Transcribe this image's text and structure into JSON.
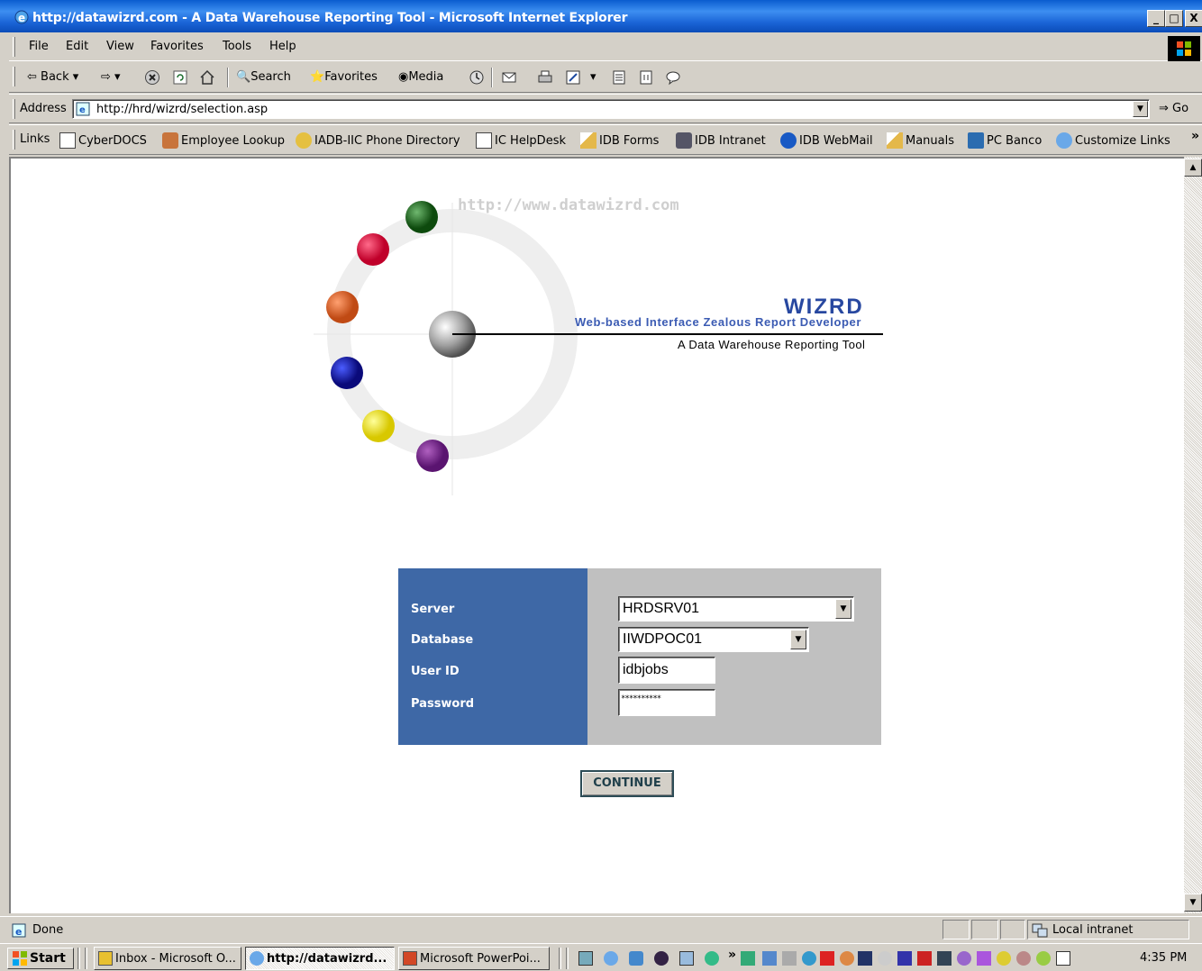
{
  "window": {
    "title": "http://datawizrd.com - A Data Warehouse Reporting Tool - Microsoft Internet Explorer",
    "min": "_",
    "max": "□",
    "close": "X"
  },
  "menu": [
    "File",
    "Edit",
    "View",
    "Favorites",
    "Tools",
    "Help"
  ],
  "toolbar": {
    "back": "Back",
    "search": "Search",
    "favorites": "Favorites",
    "media": "Media"
  },
  "address": {
    "label": "Address",
    "url": "http://hrd/wizrd/selection.asp",
    "go": "Go"
  },
  "links": {
    "label": "Links",
    "items": [
      "CyberDOCS",
      "Employee Lookup",
      "IADB-IIC Phone Directory",
      "IC HelpDesk",
      "IDB Forms",
      "IDB Intranet",
      "IDB WebMail",
      "Manuals",
      "PC Banco",
      "Customize Links"
    ],
    "more": "»"
  },
  "page": {
    "site_url": "http://www.datawizrd.com",
    "brand": "WIZRD",
    "tagline": "Web-based Interface Zealous Report Developer",
    "subtitle": "A Data Warehouse Reporting Tool"
  },
  "form": {
    "server_label": "Server",
    "server_value": "HRDSRV01",
    "database_label": "Database",
    "database_value": "IIWDPOC01",
    "userid_label": "User ID",
    "userid_value": "idbjobs",
    "password_label": "Password",
    "password_mask": "**********",
    "continue": "CONTINUE"
  },
  "status": {
    "text": "Done",
    "zone": "Local intranet"
  },
  "taskbar": {
    "start": "Start",
    "tasks": [
      "Inbox - Microsoft O...",
      "http://datawizrd...",
      "Microsoft PowerPoi..."
    ],
    "quick_more": "»",
    "clock": "4:35 PM"
  }
}
